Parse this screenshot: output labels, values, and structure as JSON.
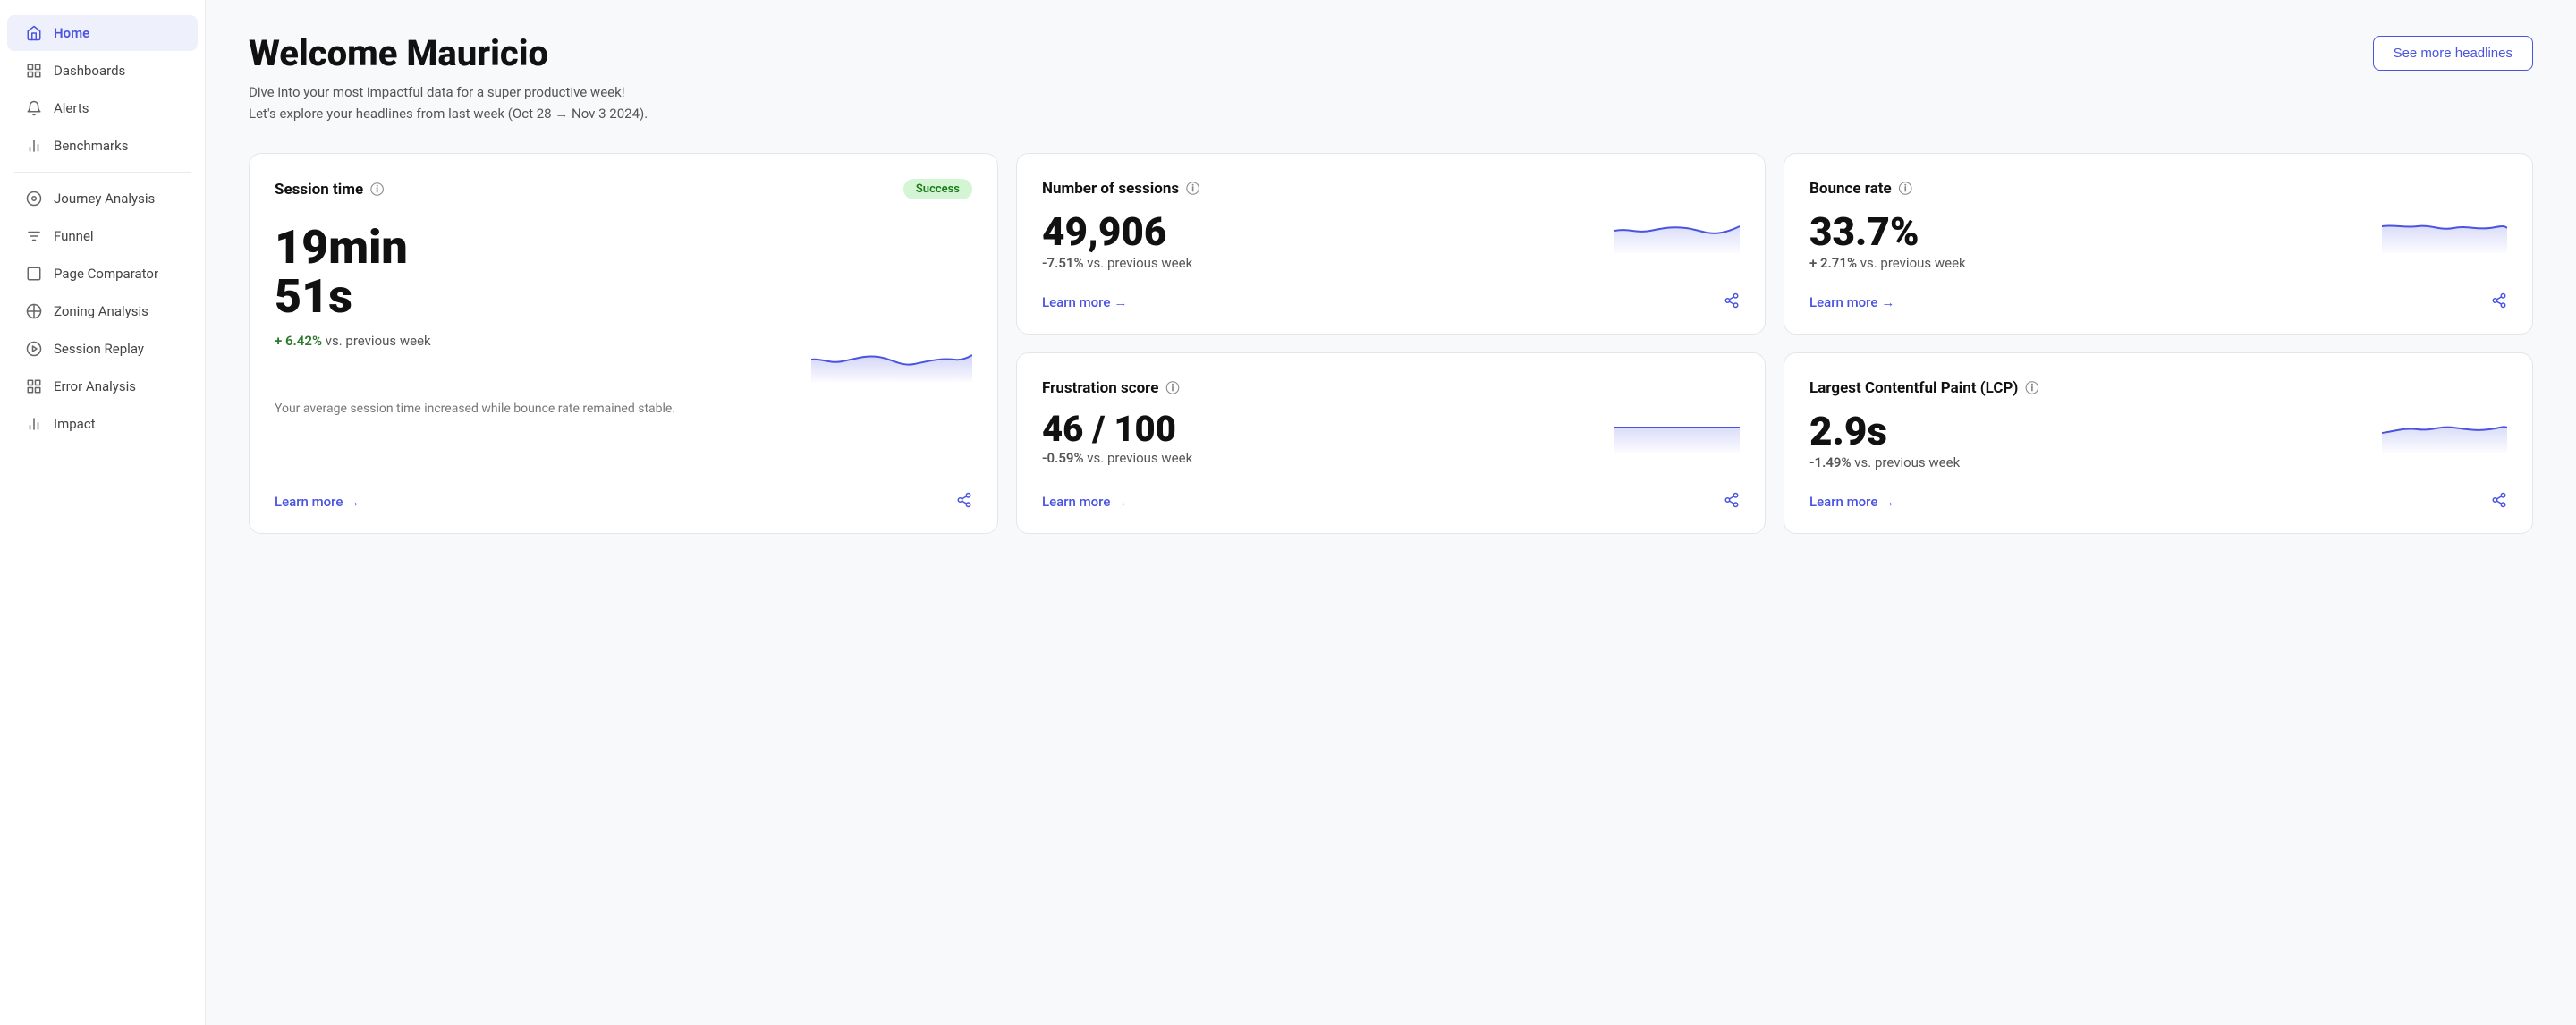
{
  "sidebar": {
    "items": [
      {
        "id": "home",
        "label": "Home",
        "icon": "home",
        "active": true
      },
      {
        "id": "dashboards",
        "label": "Dashboards",
        "icon": "grid"
      },
      {
        "id": "alerts",
        "label": "Alerts",
        "icon": "bell"
      },
      {
        "id": "benchmarks",
        "label": "Benchmarks",
        "icon": "bar-chart"
      },
      {
        "id": "journey-analysis",
        "label": "Journey Analysis",
        "icon": "circle-dot"
      },
      {
        "id": "funnel",
        "label": "Funnel",
        "icon": "funnel"
      },
      {
        "id": "page-comparator",
        "label": "Page Comparator",
        "icon": "square"
      },
      {
        "id": "zoning-analysis",
        "label": "Zoning Analysis",
        "icon": "target"
      },
      {
        "id": "session-replay",
        "label": "Session Replay",
        "icon": "play-circle"
      },
      {
        "id": "error-analysis",
        "label": "Error Analysis",
        "icon": "grid-2"
      },
      {
        "id": "impact",
        "label": "Impact",
        "icon": "bar-chart-2"
      }
    ]
  },
  "header": {
    "title": "Welcome Mauricio",
    "subtitle_line1": "Dive into your most impactful data for a super productive week!",
    "subtitle_line2": "Let's explore your headlines from last week (Oct 28 → Nov 3 2024).",
    "see_more_btn": "See more headlines"
  },
  "cards": [
    {
      "id": "session-time",
      "title": "Session time",
      "badge": "Success",
      "value": "19min",
      "value2": "51s",
      "change": "+ 6.42%",
      "change_type": "positive",
      "change_label": "vs. previous week",
      "description": "Your average session time increased while bounce rate remained stable.",
      "learn_more": "Learn more",
      "large": true
    },
    {
      "id": "number-of-sessions",
      "title": "Number of sessions",
      "value": "49,906",
      "change": "-7.51%",
      "change_type": "negative",
      "change_label": "vs. previous week",
      "learn_more": "Learn more"
    },
    {
      "id": "bounce-rate",
      "title": "Bounce rate",
      "value": "33.7%",
      "change": "+ 2.71%",
      "change_type": "negative",
      "change_label": "vs. previous week",
      "learn_more": "Learn more"
    },
    {
      "id": "frustration-score",
      "title": "Frustration score",
      "value": "46 / 100",
      "change": "-0.59%",
      "change_type": "negative",
      "change_label": "vs. previous week",
      "learn_more": "Learn more"
    },
    {
      "id": "lcp",
      "title": "Largest Contentful Paint (LCP)",
      "value": "2.9s",
      "change": "-1.49%",
      "change_type": "negative",
      "change_label": "vs. previous week",
      "learn_more": "Learn more"
    }
  ],
  "colors": {
    "accent": "#4a54e1",
    "success_bg": "#d4f5d4",
    "success_text": "#1a7a1a",
    "spark_line": "#4a54e1",
    "spark_fill": "rgba(74, 84, 225, 0.1)"
  }
}
